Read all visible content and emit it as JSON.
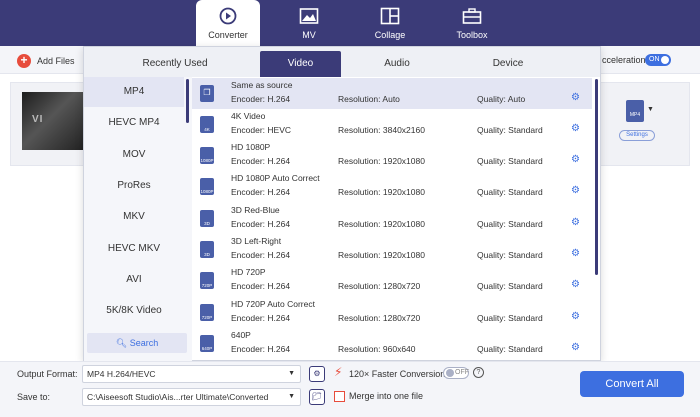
{
  "nav": {
    "items": [
      {
        "label": "Converter",
        "icon": "converter-icon"
      },
      {
        "label": "MV",
        "icon": "image-icon"
      },
      {
        "label": "Collage",
        "icon": "collage-icon"
      },
      {
        "label": "Toolbox",
        "icon": "toolbox-icon"
      }
    ]
  },
  "toolbar": {
    "add_files": "Add Files",
    "acceleration": "cceleration",
    "accel_toggle": "ON"
  },
  "file": {
    "thumb_text": "VI",
    "format_icon_text": "MP4",
    "settings": "Settings"
  },
  "panel": {
    "tabs": [
      "Recently Used",
      "Video",
      "Audio",
      "Device"
    ],
    "formats": [
      "MP4",
      "HEVC MP4",
      "MOV",
      "ProRes",
      "MKV",
      "HEVC MKV",
      "AVI",
      "5K/8K Video"
    ],
    "search": "Search",
    "presets": [
      {
        "name": "Same as source",
        "icon_text": "",
        "encoder": "Encoder: H.264",
        "resolution": "Resolution: Auto",
        "quality": "Quality: Auto"
      },
      {
        "name": "4K Video",
        "icon_text": "4K",
        "encoder": "Encoder: HEVC",
        "resolution": "Resolution: 3840x2160",
        "quality": "Quality: Standard"
      },
      {
        "name": "HD 1080P",
        "icon_text": "1080P",
        "encoder": "Encoder: H.264",
        "resolution": "Resolution: 1920x1080",
        "quality": "Quality: Standard"
      },
      {
        "name": "HD 1080P Auto Correct",
        "icon_text": "1080P",
        "encoder": "Encoder: H.264",
        "resolution": "Resolution: 1920x1080",
        "quality": "Quality: Standard"
      },
      {
        "name": "3D Red-Blue",
        "icon_text": "3D",
        "encoder": "Encoder: H.264",
        "resolution": "Resolution: 1920x1080",
        "quality": "Quality: Standard"
      },
      {
        "name": "3D Left-Right",
        "icon_text": "3D",
        "encoder": "Encoder: H.264",
        "resolution": "Resolution: 1920x1080",
        "quality": "Quality: Standard"
      },
      {
        "name": "HD 720P",
        "icon_text": "720P",
        "encoder": "Encoder: H.264",
        "resolution": "Resolution: 1280x720",
        "quality": "Quality: Standard"
      },
      {
        "name": "HD 720P Auto Correct",
        "icon_text": "720P",
        "encoder": "Encoder: H.264",
        "resolution": "Resolution: 1280x720",
        "quality": "Quality: Standard"
      },
      {
        "name": "640P",
        "icon_text": "640P",
        "encoder": "Encoder: H.264",
        "resolution": "Resolution: 960x640",
        "quality": "Quality: Standard"
      }
    ]
  },
  "bottom": {
    "output_format_label": "Output Format:",
    "output_format_value": "MP4 H.264/HEVC",
    "save_to_label": "Save to:",
    "save_to_value": "C:\\Aiseesoft Studio\\Ais...rter Ultimate\\Converted",
    "faster_conversion": "120× Faster Conversion",
    "faster_toggle": "OFF",
    "merge": "Merge into one file",
    "convert_all": "Convert All"
  },
  "colors": {
    "nav_bg": "#3b3b78",
    "accent": "#3d6fe0",
    "danger": "#e74c3c"
  }
}
